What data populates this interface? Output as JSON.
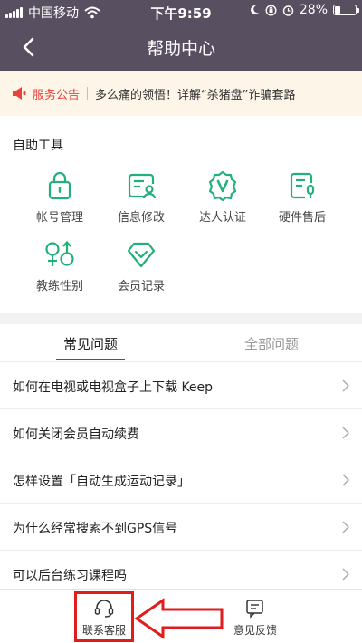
{
  "status_bar": {
    "carrier": "中国移动",
    "time": "下午9:59",
    "battery": "28%",
    "battery_level": 0.28
  },
  "nav": {
    "title": "帮助中心",
    "back_icon": "chevron-left-icon"
  },
  "notice": {
    "icon": "megaphone-icon",
    "label": "服务公告",
    "text": "多么痛的领悟！详解“杀猪盘”诈骗套路"
  },
  "tools": {
    "heading": "自助工具",
    "items": [
      {
        "label": "帐号管理",
        "icon": "lock-icon"
      },
      {
        "label": "信息修改",
        "icon": "profile-card-icon"
      },
      {
        "label": "达人认证",
        "icon": "verified-badge-icon"
      },
      {
        "label": "硬件售后",
        "icon": "device-service-icon"
      },
      {
        "label": "教练性别",
        "icon": "gender-icon"
      },
      {
        "label": "会员记录",
        "icon": "diamond-icon"
      }
    ],
    "accent_color": "#24b07a"
  },
  "faq": {
    "tabs": [
      {
        "label": "常见问题",
        "active": true
      },
      {
        "label": "全部问题",
        "active": false
      }
    ],
    "questions": [
      "如何在电视或电视盒子上下载 Keep",
      "如何关闭会员自动续费",
      "怎样设置「自动生成运动记录」",
      "为什么经常搜索不到GPS信号",
      "可以后台练习课程吗"
    ]
  },
  "bottom_bar": {
    "contact_label": "联系客服",
    "contact_icon": "headset-icon",
    "feedback_label": "意见反馈",
    "feedback_icon": "feedback-icon"
  },
  "colors": {
    "header_bg": "#584f60",
    "notice_bg": "#fdf6e8",
    "notice_label": "#e8423b",
    "annotation_red": "#e01c1c"
  }
}
